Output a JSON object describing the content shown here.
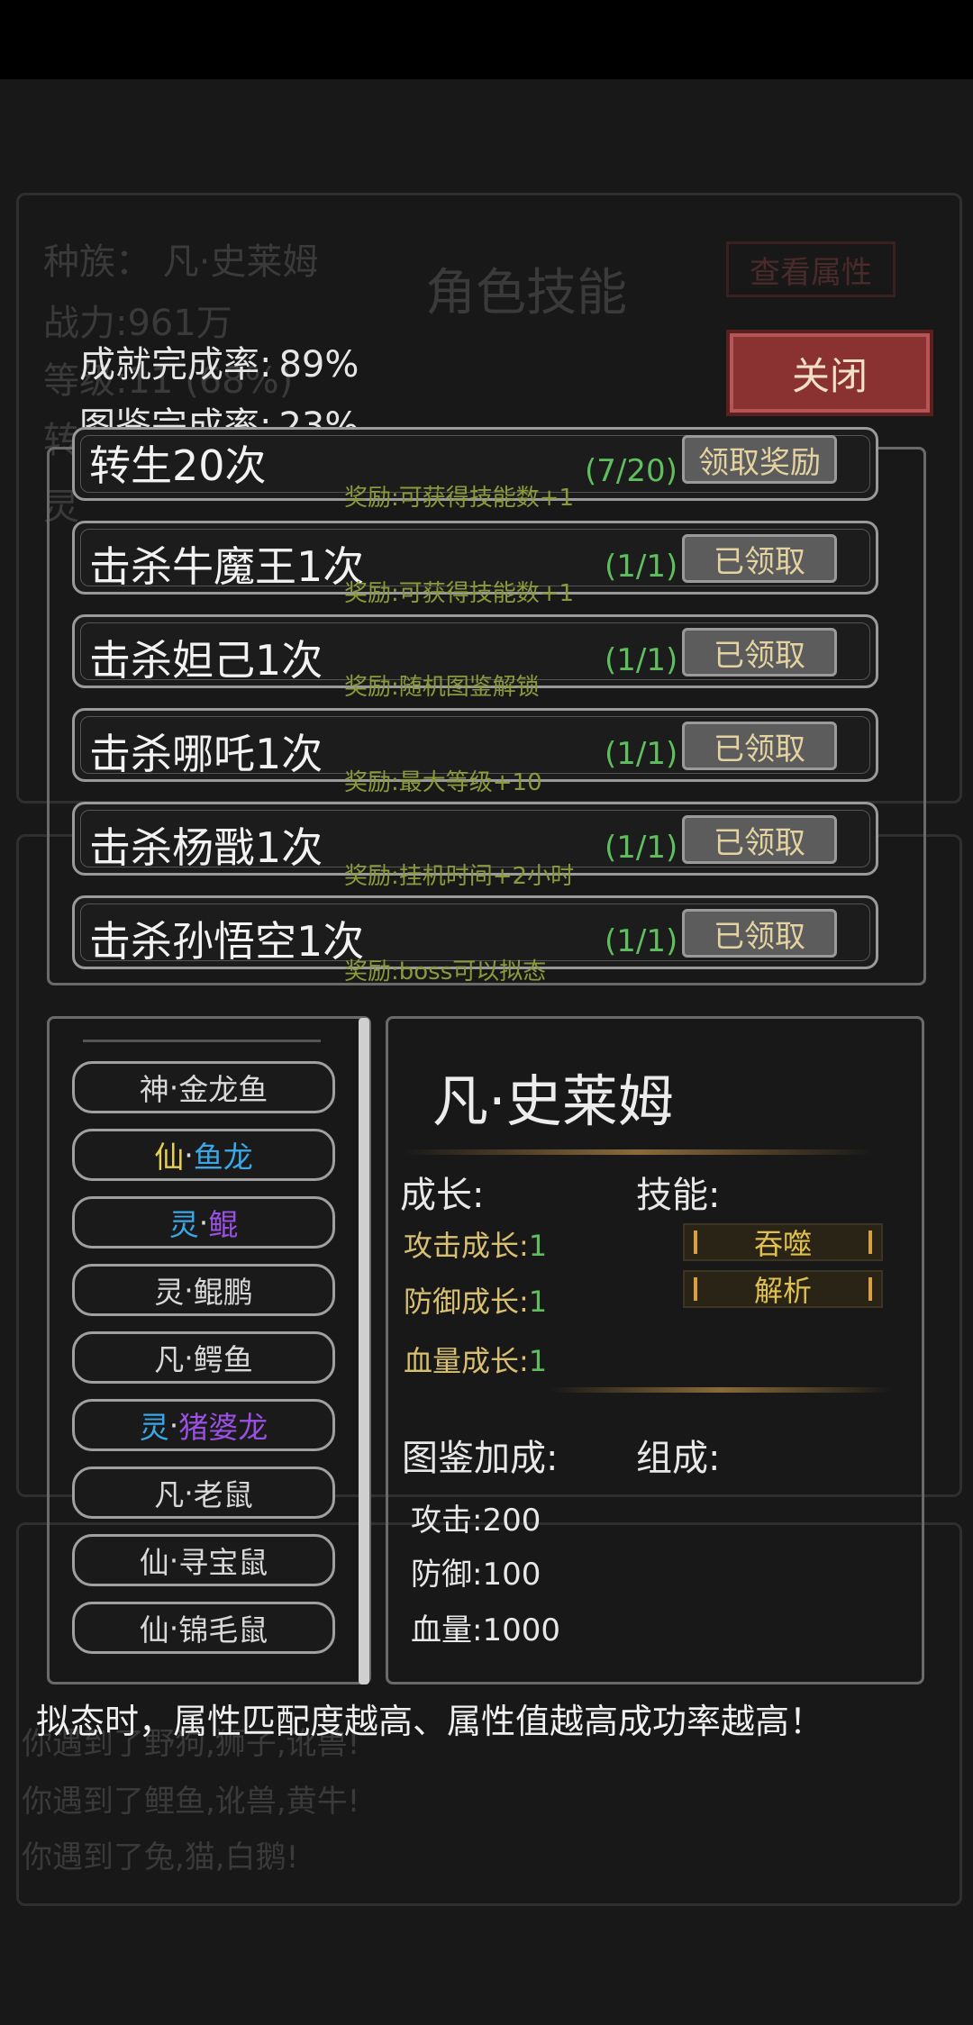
{
  "background": {
    "race_line": "种族：   凡·史莱姆",
    "power_line": "战力:961万",
    "level_line": "等级:11 (68%)",
    "zhuan": "转",
    "ling": "灵",
    "skills_title": "角色技能",
    "view_attr": "查看属性",
    "log_lines": [
      "你遇到了野狗,狮子,讹兽!",
      "你遇到了鲤鱼,讹兽,黄牛!",
      "你遇到了兔,猫,白鹅!"
    ]
  },
  "stats": {
    "achievement_label": "成就完成率",
    "achievement_value": "89%",
    "catalog_label": "图鉴完成率",
    "catalog_value": "23%"
  },
  "close_label": "关闭",
  "achievements": [
    {
      "title": "转生20次",
      "progress": "(7/20)",
      "button": "领取奖励",
      "reward": "奖励:可获得技能数+1"
    },
    {
      "title": "击杀牛魔王1次",
      "progress": "(1/1)",
      "button": "已领取",
      "reward": "奖励:可获得技能数+1"
    },
    {
      "title": "击杀妲己1次",
      "progress": "(1/1)",
      "button": "已领取",
      "reward": "奖励:随机图鉴解锁"
    },
    {
      "title": "击杀哪吒1次",
      "progress": "(1/1)",
      "button": "已领取",
      "reward": "奖励:最大等级+10"
    },
    {
      "title": "击杀杨戬1次",
      "progress": "(1/1)",
      "button": "已领取",
      "reward": "奖励:挂机时间+2小时"
    },
    {
      "title": "击杀孙悟空1次",
      "progress": "(1/1)",
      "button": "已领取",
      "reward": "奖励:boss可以拟态"
    }
  ],
  "monster_list": [
    {
      "prefix": "神",
      "sep": "·",
      "name": "金龙鱼",
      "prefix_color": "#d8d8d8",
      "name_color": "#d8d8d8"
    },
    {
      "prefix": "仙",
      "sep": "·",
      "name": "鱼龙",
      "prefix_color": "#e8d050",
      "name_color": "#3aa8e8"
    },
    {
      "prefix": "灵",
      "sep": "·",
      "name": "鲲",
      "prefix_color": "#3aa8e8",
      "name_color": "#9a50e0"
    },
    {
      "prefix": "灵",
      "sep": "·",
      "name": "鲲鹏",
      "prefix_color": "#d8d8d8",
      "name_color": "#d8d8d8"
    },
    {
      "prefix": "凡",
      "sep": "·",
      "name": "鳄鱼",
      "prefix_color": "#d8d8d8",
      "name_color": "#d8d8d8"
    },
    {
      "prefix": "灵",
      "sep": "·",
      "name": "猪婆龙",
      "prefix_color": "#3aa8e8",
      "name_color": "#9a50e0"
    },
    {
      "prefix": "凡",
      "sep": "·",
      "name": "老鼠",
      "prefix_color": "#d8d8d8",
      "name_color": "#d8d8d8"
    },
    {
      "prefix": "仙",
      "sep": "·",
      "name": "寻宝鼠",
      "prefix_color": "#d8d8d8",
      "name_color": "#d8d8d8"
    },
    {
      "prefix": "仙",
      "sep": "·",
      "name": "锦毛鼠",
      "prefix_color": "#d8d8d8",
      "name_color": "#d8d8d8"
    }
  ],
  "detail": {
    "name": "凡·史莱姆",
    "growth_label": "成长:",
    "skills_label": "技能:",
    "growth": [
      {
        "label": "攻击成长",
        "value": "1"
      },
      {
        "label": "防御成长",
        "value": "1"
      },
      {
        "label": "血量成长",
        "value": "1"
      }
    ],
    "skills": [
      "吞噬",
      "解析"
    ],
    "bonus_label": "图鉴加成:",
    "compose_label": "组成:",
    "bonus": [
      {
        "label": "攻击",
        "value": "200"
      },
      {
        "label": "防御",
        "value": "100"
      },
      {
        "label": "血量",
        "value": "1000"
      }
    ]
  },
  "tip": "拟态时，属性匹配度越高、属性值越高成功率越高！"
}
